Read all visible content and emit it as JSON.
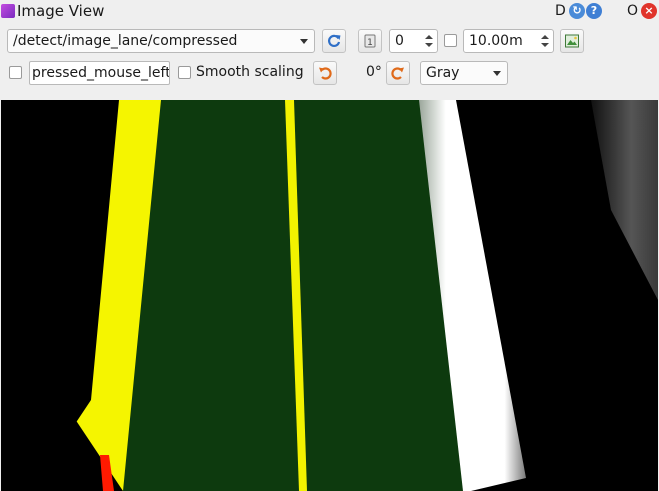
{
  "window": {
    "title": "Image View",
    "d_label": "D",
    "o_label": "O"
  },
  "toolbar": {
    "topic": "/detect/image_lane/compressed",
    "frame_number": "0",
    "duration": "10.00m",
    "mouse_topic": "pressed_mouse_left",
    "smooth_scaling_label": "Smooth scaling",
    "rotation": "0°",
    "color_scheme": "Gray"
  },
  "icons": {
    "refresh": "refresh-icon",
    "zoom": "zoom-1-icon",
    "save": "save-image-icon",
    "rotate_left": "rotate-left-icon",
    "rotate_right": "rotate-right-icon"
  },
  "colors": {
    "lane_green": "#0d3a0e",
    "yellow_line": "#f5f500",
    "white_line": "#ffffff",
    "red_mark": "#ff1a00",
    "close": "#e0342b",
    "accent_blue": "#4a8bd8"
  }
}
